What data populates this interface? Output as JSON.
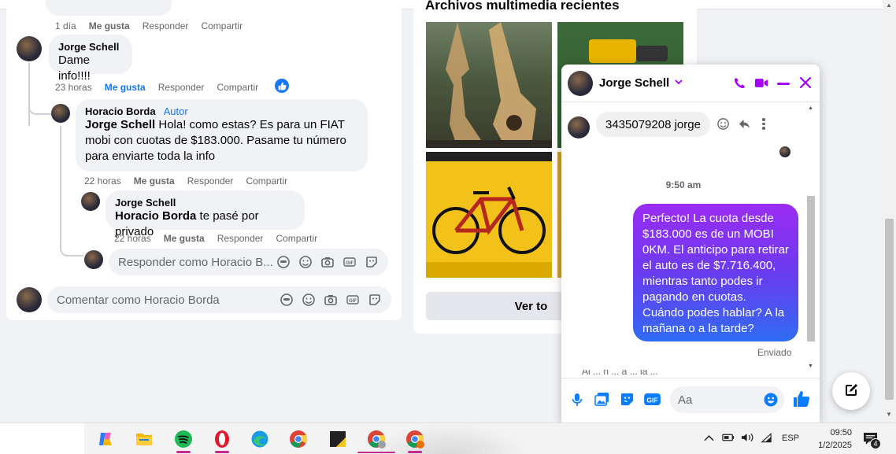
{
  "comments": {
    "first_meta": {
      "time": "1 día",
      "like": "Me gusta",
      "reply": "Responder",
      "share": "Compartir"
    },
    "c1": {
      "name": "Jorge Schell",
      "text": "Dame info!!!!",
      "time": "23 horas",
      "like": "Me gusta",
      "reply": "Responder",
      "share": "Compartir"
    },
    "c2": {
      "name": "Horacio Borda",
      "badge": "Autor",
      "mention": "Jorge Schell",
      "text": " Hola! como estas? Es para un FIAT mobi con cuotas de $183.000. Pasame tu número para enviarte toda la info",
      "time": "22 horas",
      "like": "Me gusta",
      "reply": "Responder",
      "share": "Compartir"
    },
    "c3": {
      "name": "Jorge Schell",
      "mention": "Horacio Borda",
      "text": " te pasé por privado",
      "time": "22 horas",
      "like": "Me gusta",
      "reply": "Responder",
      "share": "Compartir"
    },
    "reply_placeholder": "Responder como Horacio B...",
    "comment_placeholder": "Comentar como Horacio Borda"
  },
  "media": {
    "title": "Archivos multimedia recientes",
    "see_all": "Ver to"
  },
  "messenger": {
    "contact": "Jorge Schell",
    "incoming": "3435079208 jorge",
    "time": "9:50 am",
    "outgoing": "Perfecto! La cuota desde $183.000 es de un MOBI 0KM. El anticipo para retirar el auto es de $7.716.400, mientras tanto podes ir pagando en cuotas. Cuándo podes hablar? A la mañana o a la tarde?",
    "status": "Enviado",
    "cut_text": "Al ... n ... a ... la ...",
    "input_placeholder": "Aa",
    "accent": "#a400ff"
  },
  "taskbar": {
    "lang": "ESP",
    "time": "09:50",
    "date": "1/2/2025",
    "notif_count": "4"
  }
}
